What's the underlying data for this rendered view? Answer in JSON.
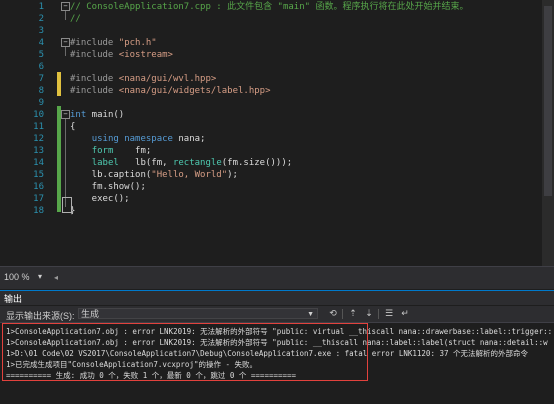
{
  "editor": {
    "lines": [
      {
        "n": "1",
        "tokens": [
          {
            "c": "cmt",
            "t": "// ConsoleApplication7.cpp : 此文件包含 \"main\" 函数。程序执行将在此处开始并结束。"
          }
        ]
      },
      {
        "n": "2",
        "tokens": [
          {
            "c": "cmt",
            "t": "//"
          }
        ]
      },
      {
        "n": "3",
        "tokens": []
      },
      {
        "n": "4",
        "tokens": [
          {
            "c": "inc",
            "t": "#include "
          },
          {
            "c": "str",
            "t": "\"pch.h\""
          }
        ]
      },
      {
        "n": "5",
        "tokens": [
          {
            "c": "inc",
            "t": "#include "
          },
          {
            "c": "str",
            "t": "<iostream>"
          }
        ]
      },
      {
        "n": "6",
        "tokens": []
      },
      {
        "n": "7",
        "tokens": [
          {
            "c": "inc",
            "t": "#include "
          },
          {
            "c": "str",
            "t": "<nana/gui/wvl.hpp>"
          }
        ]
      },
      {
        "n": "8",
        "tokens": [
          {
            "c": "inc",
            "t": "#include "
          },
          {
            "c": "str",
            "t": "<nana/gui/widgets/label.hpp>"
          }
        ]
      },
      {
        "n": "9",
        "tokens": []
      },
      {
        "n": "10",
        "tokens": [
          {
            "c": "kw",
            "t": "int"
          },
          {
            "c": "",
            "t": " main()"
          }
        ]
      },
      {
        "n": "11",
        "tokens": [
          {
            "c": "",
            "t": "{"
          }
        ]
      },
      {
        "n": "12",
        "tokens": [
          {
            "c": "",
            "t": "    "
          },
          {
            "c": "kw",
            "t": "using namespace"
          },
          {
            "c": "",
            "t": " nana;"
          }
        ]
      },
      {
        "n": "13",
        "tokens": [
          {
            "c": "",
            "t": "    "
          },
          {
            "c": "type",
            "t": "form"
          },
          {
            "c": "",
            "t": "    fm;"
          }
        ]
      },
      {
        "n": "14",
        "tokens": [
          {
            "c": "",
            "t": "    "
          },
          {
            "c": "type",
            "t": "label"
          },
          {
            "c": "",
            "t": "   lb(fm, "
          },
          {
            "c": "type",
            "t": "rectangle"
          },
          {
            "c": "",
            "t": "(fm.size()));"
          }
        ]
      },
      {
        "n": "15",
        "tokens": [
          {
            "c": "",
            "t": "    lb.caption("
          },
          {
            "c": "str",
            "t": "\"Hello, World\""
          },
          {
            "c": "",
            "t": ");"
          }
        ]
      },
      {
        "n": "16",
        "tokens": [
          {
            "c": "",
            "t": "    fm.show();"
          }
        ]
      },
      {
        "n": "17",
        "tokens": [
          {
            "c": "",
            "t": "    exec();"
          }
        ]
      },
      {
        "n": "18",
        "tokens": [
          {
            "c": "",
            "t": "}"
          }
        ]
      }
    ]
  },
  "status": {
    "zoom": "100 %"
  },
  "output": {
    "title": "输出",
    "source_label": "显示输出来源(S):",
    "source_value": "生成",
    "lines": [
      "1>ConsoleApplication7.obj : error LNK2019: 无法解析的外部符号 \"public: virtual __thiscall nana::drawerbase::label::trigger::",
      "1>ConsoleApplication7.obj : error LNK2019: 无法解析的外部符号 \"public: __thiscall nana::label::label(struct nana::detail::w",
      "1>D:\\01 Code\\02 VS2017\\ConsoleApplication7\\Debug\\ConsoleApplication7.exe : fatal error LNK1120: 37 个无法解析的外部命令",
      "1>已完成生成项目\"ConsoleApplication7.vcxproj\"的操作 - 失败。",
      "========== 生成: 成功 0 个，失败 1 个，最新 0 个，跳过 0 个 =========="
    ]
  },
  "colors": {
    "accent": "#007acc",
    "highlight_box": "#e2423d",
    "comment": "#57a64a",
    "keyword": "#569cd6"
  }
}
